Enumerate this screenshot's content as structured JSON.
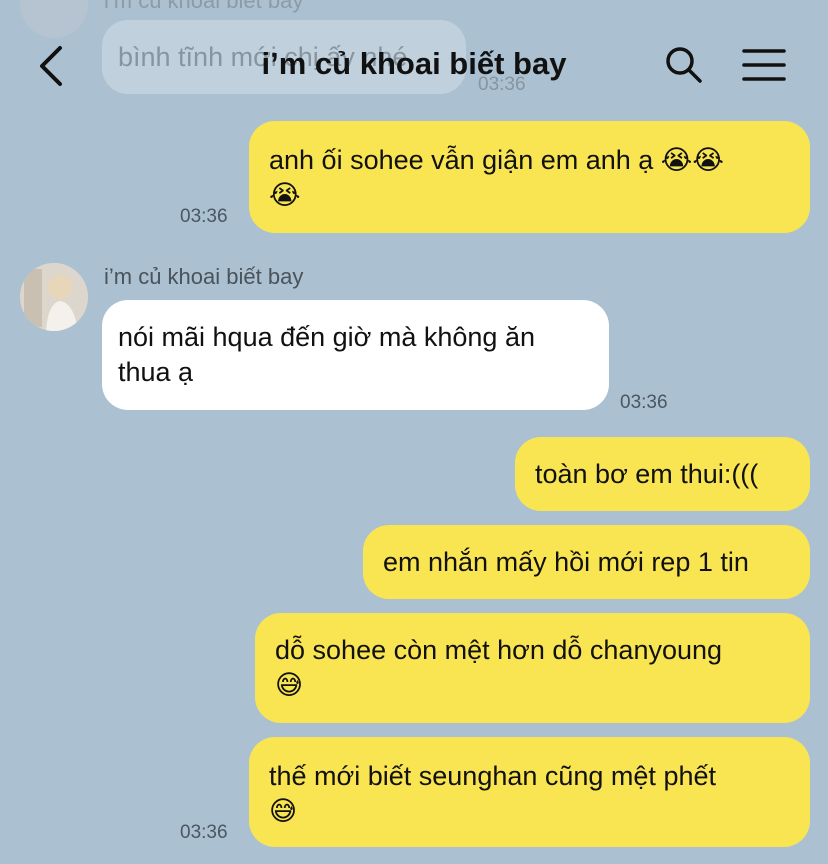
{
  "background_color": "#abc1d1",
  "outgoing_bubble_color": "#f9e551",
  "incoming_bubble_color": "#ffffff",
  "header": {
    "title": "i’m củ khoai biết bay",
    "back_icon": "chevron-left-icon",
    "search_icon": "search-icon",
    "menu_icon": "hamburger-menu-icon"
  },
  "ghost": {
    "sender": "i’m củ khoai biết bay",
    "text": "bình tĩnh mới chị ấy nhé",
    "time": "03:36"
  },
  "contact": {
    "name": "i’m củ khoai biết bay"
  },
  "messages": [
    {
      "direction": "out",
      "line1": "anh ối sohee vẫn giận em anh ạ 😭😭",
      "line2": "😭",
      "time": "03:36"
    },
    {
      "direction": "in",
      "line1": "nói mãi hqua đến giờ mà không ăn",
      "line2": "thua ạ",
      "time": "03:36"
    },
    {
      "direction": "out",
      "line1": "toàn bơ em thui:((("
    },
    {
      "direction": "out",
      "line1": "em nhắn mấy hồi mới rep 1 tin"
    },
    {
      "direction": "out",
      "line1": "dỗ sohee còn mệt hơn dỗ chanyoung",
      "line2": "😅"
    },
    {
      "direction": "out",
      "line1": "thế mới biết seunghan cũng mệt phết",
      "line2": "😅",
      "time": "03:36"
    }
  ]
}
